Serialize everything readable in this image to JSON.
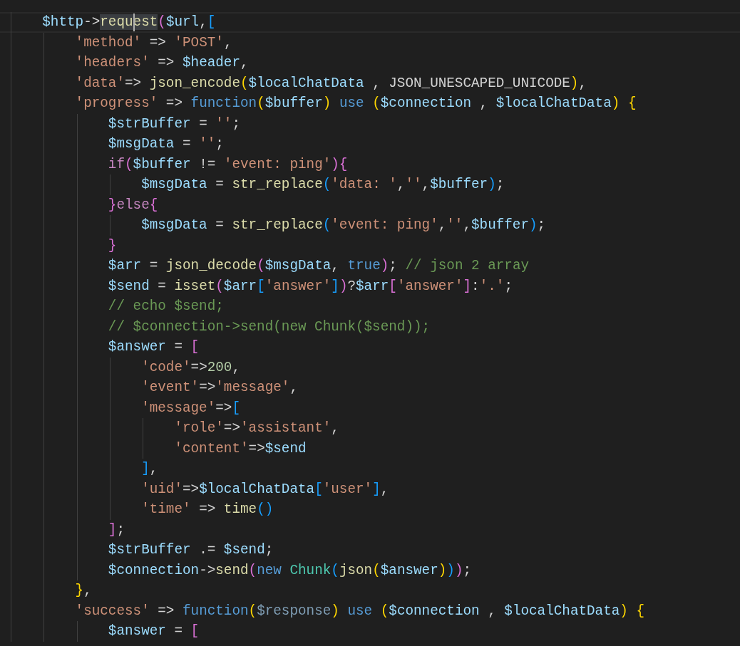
{
  "editor": {
    "lines": [
      {
        "current": true,
        "tokens": [
          {
            "kind": "v",
            "text": "    $http"
          },
          {
            "kind": "o",
            "text": "->"
          },
          {
            "kind": "f",
            "text": "requ",
            "highlighted": true,
            "caret": true
          },
          {
            "kind": "f",
            "text": "est",
            "highlighted": true
          },
          {
            "kind": "p",
            "text": "("
          },
          {
            "kind": "v",
            "text": "$url"
          },
          {
            "kind": "o",
            "text": ","
          },
          {
            "kind": "b",
            "text": "["
          }
        ]
      },
      {
        "current": false,
        "tokens": [
          {
            "kind": "s",
            "text": "        'method'"
          },
          {
            "kind": "o",
            "text": " => "
          },
          {
            "kind": "s",
            "text": "'POST'"
          },
          {
            "kind": "o",
            "text": ","
          }
        ]
      },
      {
        "current": false,
        "tokens": [
          {
            "kind": "s",
            "text": "        'headers'"
          },
          {
            "kind": "o",
            "text": " => "
          },
          {
            "kind": "v",
            "text": "$header"
          },
          {
            "kind": "o",
            "text": ","
          }
        ]
      },
      {
        "current": false,
        "tokens": [
          {
            "kind": "s",
            "text": "        'data'"
          },
          {
            "kind": "o",
            "text": "=> "
          },
          {
            "kind": "f",
            "text": "json_encode"
          },
          {
            "kind": "y",
            "text": "("
          },
          {
            "kind": "v",
            "text": "$localChatData"
          },
          {
            "kind": "o",
            "text": " , JSON_UNESCAPED_UNICODE"
          },
          {
            "kind": "y",
            "text": ")"
          },
          {
            "kind": "o",
            "text": ","
          }
        ]
      },
      {
        "current": false,
        "tokens": [
          {
            "kind": "s",
            "text": "        'progress'"
          },
          {
            "kind": "o",
            "text": " => "
          },
          {
            "kind": "k",
            "text": "function"
          },
          {
            "kind": "y",
            "text": "("
          },
          {
            "kind": "v",
            "text": "$buffer"
          },
          {
            "kind": "y",
            "text": ")"
          },
          {
            "kind": "k",
            "text": " use "
          },
          {
            "kind": "y",
            "text": "("
          },
          {
            "kind": "v",
            "text": "$connection"
          },
          {
            "kind": "o",
            "text": " , "
          },
          {
            "kind": "v",
            "text": "$localChatData"
          },
          {
            "kind": "y",
            "text": ") {"
          }
        ]
      },
      {
        "current": false,
        "tokens": [
          {
            "kind": "v",
            "text": "            $strBuffer"
          },
          {
            "kind": "o",
            "text": " = "
          },
          {
            "kind": "s",
            "text": "''"
          },
          {
            "kind": "o",
            "text": ";"
          }
        ]
      },
      {
        "current": false,
        "tokens": [
          {
            "kind": "v",
            "text": "            $msgData"
          },
          {
            "kind": "o",
            "text": " = "
          },
          {
            "kind": "s",
            "text": "''"
          },
          {
            "kind": "o",
            "text": ";"
          }
        ]
      },
      {
        "current": false,
        "tokens": [
          {
            "kind": "c",
            "text": "            if"
          },
          {
            "kind": "p",
            "text": "("
          },
          {
            "kind": "v",
            "text": "$buffer"
          },
          {
            "kind": "o",
            "text": " != "
          },
          {
            "kind": "s",
            "text": "'event: ping'"
          },
          {
            "kind": "p",
            "text": "){"
          }
        ]
      },
      {
        "current": false,
        "tokens": [
          {
            "kind": "v",
            "text": "                $msgData"
          },
          {
            "kind": "o",
            "text": " = "
          },
          {
            "kind": "f",
            "text": "str_replace"
          },
          {
            "kind": "b",
            "text": "("
          },
          {
            "kind": "s",
            "text": "'data: '"
          },
          {
            "kind": "o",
            "text": ","
          },
          {
            "kind": "s",
            "text": "''"
          },
          {
            "kind": "o",
            "text": ","
          },
          {
            "kind": "v",
            "text": "$buffer"
          },
          {
            "kind": "b",
            "text": ")"
          },
          {
            "kind": "o",
            "text": ";"
          }
        ]
      },
      {
        "current": false,
        "tokens": [
          {
            "kind": "p",
            "text": "            }"
          },
          {
            "kind": "c",
            "text": "else"
          },
          {
            "kind": "p",
            "text": "{"
          }
        ]
      },
      {
        "current": false,
        "tokens": [
          {
            "kind": "v",
            "text": "                $msgData"
          },
          {
            "kind": "o",
            "text": " = "
          },
          {
            "kind": "f",
            "text": "str_replace"
          },
          {
            "kind": "b",
            "text": "("
          },
          {
            "kind": "s",
            "text": "'event: ping'"
          },
          {
            "kind": "o",
            "text": ","
          },
          {
            "kind": "s",
            "text": "''"
          },
          {
            "kind": "o",
            "text": ","
          },
          {
            "kind": "v",
            "text": "$buffer"
          },
          {
            "kind": "b",
            "text": ")"
          },
          {
            "kind": "o",
            "text": ";"
          }
        ]
      },
      {
        "current": false,
        "tokens": [
          {
            "kind": "p",
            "text": "            }"
          }
        ]
      },
      {
        "current": false,
        "tokens": [
          {
            "kind": "v",
            "text": "            $arr"
          },
          {
            "kind": "o",
            "text": " = "
          },
          {
            "kind": "f",
            "text": "json_decode"
          },
          {
            "kind": "p",
            "text": "("
          },
          {
            "kind": "v",
            "text": "$msgData"
          },
          {
            "kind": "o",
            "text": ", "
          },
          {
            "kind": "k",
            "text": "true"
          },
          {
            "kind": "p",
            "text": ")"
          },
          {
            "kind": "o",
            "text": "; "
          },
          {
            "kind": "m",
            "text": "// json 2 array"
          }
        ]
      },
      {
        "current": false,
        "tokens": [
          {
            "kind": "v",
            "text": "            $send"
          },
          {
            "kind": "o",
            "text": " = "
          },
          {
            "kind": "f",
            "text": "isset"
          },
          {
            "kind": "p",
            "text": "("
          },
          {
            "kind": "v",
            "text": "$arr"
          },
          {
            "kind": "b",
            "text": "["
          },
          {
            "kind": "s",
            "text": "'answer'"
          },
          {
            "kind": "b",
            "text": "]"
          },
          {
            "kind": "p",
            "text": ")"
          },
          {
            "kind": "o",
            "text": "?"
          },
          {
            "kind": "v",
            "text": "$arr"
          },
          {
            "kind": "p",
            "text": "["
          },
          {
            "kind": "s",
            "text": "'answer'"
          },
          {
            "kind": "p",
            "text": "]"
          },
          {
            "kind": "o",
            "text": ":"
          },
          {
            "kind": "s",
            "text": "'.'"
          },
          {
            "kind": "o",
            "text": ";"
          }
        ]
      },
      {
        "current": false,
        "tokens": [
          {
            "kind": "m",
            "text": "            // echo $send;"
          }
        ]
      },
      {
        "current": false,
        "tokens": [
          {
            "kind": "m",
            "text": "            // $connection->send(new Chunk($send));"
          }
        ]
      },
      {
        "current": false,
        "tokens": [
          {
            "kind": "v",
            "text": "            $answer"
          },
          {
            "kind": "o",
            "text": " = "
          },
          {
            "kind": "p",
            "text": "["
          }
        ]
      },
      {
        "current": false,
        "tokens": [
          {
            "kind": "s",
            "text": "                'code'"
          },
          {
            "kind": "o",
            "text": "=>"
          },
          {
            "kind": "n",
            "text": "200"
          },
          {
            "kind": "o",
            "text": ","
          }
        ]
      },
      {
        "current": false,
        "tokens": [
          {
            "kind": "s",
            "text": "                'event'"
          },
          {
            "kind": "o",
            "text": "=>"
          },
          {
            "kind": "s",
            "text": "'message'"
          },
          {
            "kind": "o",
            "text": ","
          }
        ]
      },
      {
        "current": false,
        "tokens": [
          {
            "kind": "s",
            "text": "                'message'"
          },
          {
            "kind": "o",
            "text": "=>"
          },
          {
            "kind": "b",
            "text": "["
          }
        ]
      },
      {
        "current": false,
        "tokens": [
          {
            "kind": "s",
            "text": "                    'role'"
          },
          {
            "kind": "o",
            "text": "=>"
          },
          {
            "kind": "s",
            "text": "'assistant'"
          },
          {
            "kind": "o",
            "text": ","
          }
        ]
      },
      {
        "current": false,
        "tokens": [
          {
            "kind": "s",
            "text": "                    'content'"
          },
          {
            "kind": "o",
            "text": "=>"
          },
          {
            "kind": "v",
            "text": "$send"
          }
        ]
      },
      {
        "current": false,
        "tokens": [
          {
            "kind": "b",
            "text": "                ]"
          },
          {
            "kind": "o",
            "text": ","
          }
        ]
      },
      {
        "current": false,
        "tokens": [
          {
            "kind": "s",
            "text": "                'uid'"
          },
          {
            "kind": "o",
            "text": "=>"
          },
          {
            "kind": "v",
            "text": "$localChatData"
          },
          {
            "kind": "b",
            "text": "["
          },
          {
            "kind": "s",
            "text": "'user'"
          },
          {
            "kind": "b",
            "text": "]"
          },
          {
            "kind": "o",
            "text": ","
          }
        ]
      },
      {
        "current": false,
        "tokens": [
          {
            "kind": "s",
            "text": "                'time'"
          },
          {
            "kind": "o",
            "text": " => "
          },
          {
            "kind": "f",
            "text": "time"
          },
          {
            "kind": "b",
            "text": "()"
          }
        ]
      },
      {
        "current": false,
        "tokens": [
          {
            "kind": "p",
            "text": "            ]"
          },
          {
            "kind": "o",
            "text": ";"
          }
        ]
      },
      {
        "current": false,
        "tokens": [
          {
            "kind": "v",
            "text": "            $strBuffer"
          },
          {
            "kind": "o",
            "text": " .= "
          },
          {
            "kind": "v",
            "text": "$send"
          },
          {
            "kind": "o",
            "text": ";"
          }
        ]
      },
      {
        "current": false,
        "tokens": [
          {
            "kind": "v",
            "text": "            $connection"
          },
          {
            "kind": "o",
            "text": "->"
          },
          {
            "kind": "f",
            "text": "send"
          },
          {
            "kind": "p",
            "text": "("
          },
          {
            "kind": "k",
            "text": "new "
          },
          {
            "kind": "t",
            "text": "Chunk"
          },
          {
            "kind": "b",
            "text": "("
          },
          {
            "kind": "f",
            "text": "json"
          },
          {
            "kind": "y",
            "text": "("
          },
          {
            "kind": "v",
            "text": "$answer"
          },
          {
            "kind": "y",
            "text": ")"
          },
          {
            "kind": "b",
            "text": ")"
          },
          {
            "kind": "p",
            "text": ")"
          },
          {
            "kind": "o",
            "text": ";"
          }
        ]
      },
      {
        "current": false,
        "tokens": [
          {
            "kind": "y",
            "text": "        }"
          },
          {
            "kind": "o",
            "text": ","
          }
        ]
      },
      {
        "current": false,
        "tokens": [
          {
            "kind": "s",
            "text": "        'success'"
          },
          {
            "kind": "o",
            "text": " => "
          },
          {
            "kind": "k",
            "text": "function"
          },
          {
            "kind": "y",
            "text": "("
          },
          {
            "kind": "u",
            "text": "$response"
          },
          {
            "kind": "y",
            "text": ")"
          },
          {
            "kind": "k",
            "text": " use "
          },
          {
            "kind": "y",
            "text": "("
          },
          {
            "kind": "v",
            "text": "$connection"
          },
          {
            "kind": "o",
            "text": " , "
          },
          {
            "kind": "v",
            "text": "$localChatData"
          },
          {
            "kind": "y",
            "text": ") {"
          }
        ]
      },
      {
        "current": false,
        "tokens": [
          {
            "kind": "v",
            "text": "            $answer"
          },
          {
            "kind": "o",
            "text": " = "
          },
          {
            "kind": "p",
            "text": "["
          }
        ]
      }
    ]
  }
}
